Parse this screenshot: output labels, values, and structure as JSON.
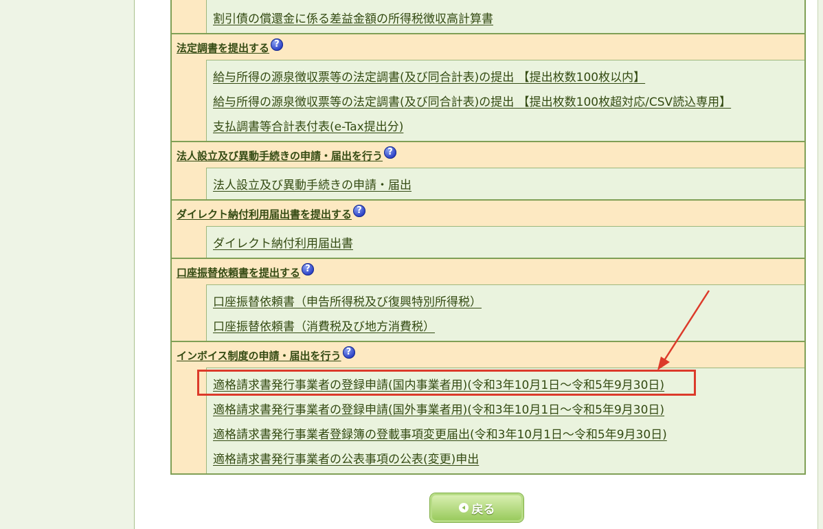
{
  "sections": [
    {
      "title": "",
      "links": [
        "割引債の償還金に係る差益金額の所得税徴収高計算書"
      ]
    },
    {
      "title": "法定調書を提出する",
      "links": [
        "給与所得の源泉徴収票等の法定調書(及び同合計表)の提出 【提出枚数100枚以内】",
        "給与所得の源泉徴収票等の法定調書(及び同合計表)の提出 【提出枚数100枚超対応/CSV読込専用】",
        "支払調書等合計表付表(e-Tax提出分)"
      ]
    },
    {
      "title": "法人設立及び異動手続きの申請・届出を行う",
      "links": [
        "法人設立及び異動手続きの申請・届出"
      ]
    },
    {
      "title": "ダイレクト納付利用届出書を提出する",
      "links": [
        "ダイレクト納付利用届出書"
      ]
    },
    {
      "title": "口座振替依頼書を提出する",
      "links": [
        "口座振替依頼書（申告所得税及び復興特別所得税）",
        "口座振替依頼書（消費税及び地方消費税）"
      ]
    },
    {
      "title": "インボイス制度の申請・届出を行う",
      "links": [
        "適格請求書発行事業者の登録申請(国内事業者用)(令和3年10月1日～令和5年9月30日)",
        "適格請求書発行事業者の登録申請(国外事業者用)(令和3年10月1日～令和5年9月30日)",
        "適格請求書発行事業者登録簿の登載事項変更届出(令和3年10月1日～令和5年9月30日)",
        "適格請求書発行事業者の公表事項の公表(変更)申出"
      ]
    }
  ],
  "help_icon_glyph": "?",
  "back_button": {
    "label": "戻る"
  },
  "colors": {
    "header_bg": "#fde9c2",
    "link_cell_bg": "#eaf3de",
    "border": "#7f9f55",
    "link_text": "#334a12",
    "highlight": "#dc3a2a"
  }
}
